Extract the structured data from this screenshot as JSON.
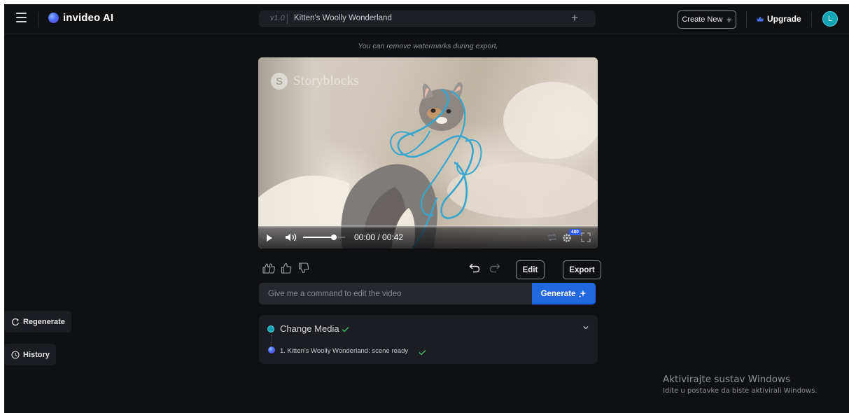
{
  "app": {
    "brand": "invideo AI"
  },
  "header": {
    "version": "v1.0",
    "project_title": "Kitten's Woolly Wonderland",
    "add_symbol": "+",
    "create_new_label": "Create New",
    "create_new_symbol": "+",
    "upgrade_label": "Upgrade",
    "avatar_initial": "L"
  },
  "notice": "You can remove watermarks during export.",
  "player": {
    "watermark_text": "Storyblocks",
    "watermark_logo_letter": "S",
    "current_time": "00:00",
    "duration": "00:42",
    "timecode": "00:00 / 00:42",
    "quality_badge": "480",
    "playback_progress": 0,
    "volume_level": 0.7
  },
  "actions": {
    "edit_label": "Edit",
    "export_label": "Export"
  },
  "command": {
    "placeholder": "Give me a command to edit the video",
    "value": "",
    "generate_label": "Generate"
  },
  "change_media": {
    "title": "Change Media",
    "step_text": "1. Kitten's Woolly Wonderland: scene ready"
  },
  "sidebar": {
    "regenerate_label": "Regenerate",
    "history_label": "History"
  },
  "windows_activation": {
    "title": "Aktivirajte sustav Windows",
    "subtitle": "Idite u postavke da biste aktivirali Windows."
  },
  "colors": {
    "background": "#0f1012",
    "accent_blue": "#2168e0",
    "avatar_teal": "#12a3b5",
    "success_green": "#3fc56b"
  },
  "icons": [
    "menu-icon",
    "invideo-logo-icon",
    "plus-icon",
    "crown-icon",
    "play-icon",
    "volume-icon",
    "loop-icon",
    "settings-icon",
    "fullscreen-icon",
    "double-thumbs-up-icon",
    "thumbs-up-icon",
    "thumbs-down-icon",
    "undo-icon",
    "redo-icon",
    "sparkle-icon",
    "chevron-down-icon",
    "check-icon",
    "regenerate-icon",
    "clock-icon"
  ]
}
